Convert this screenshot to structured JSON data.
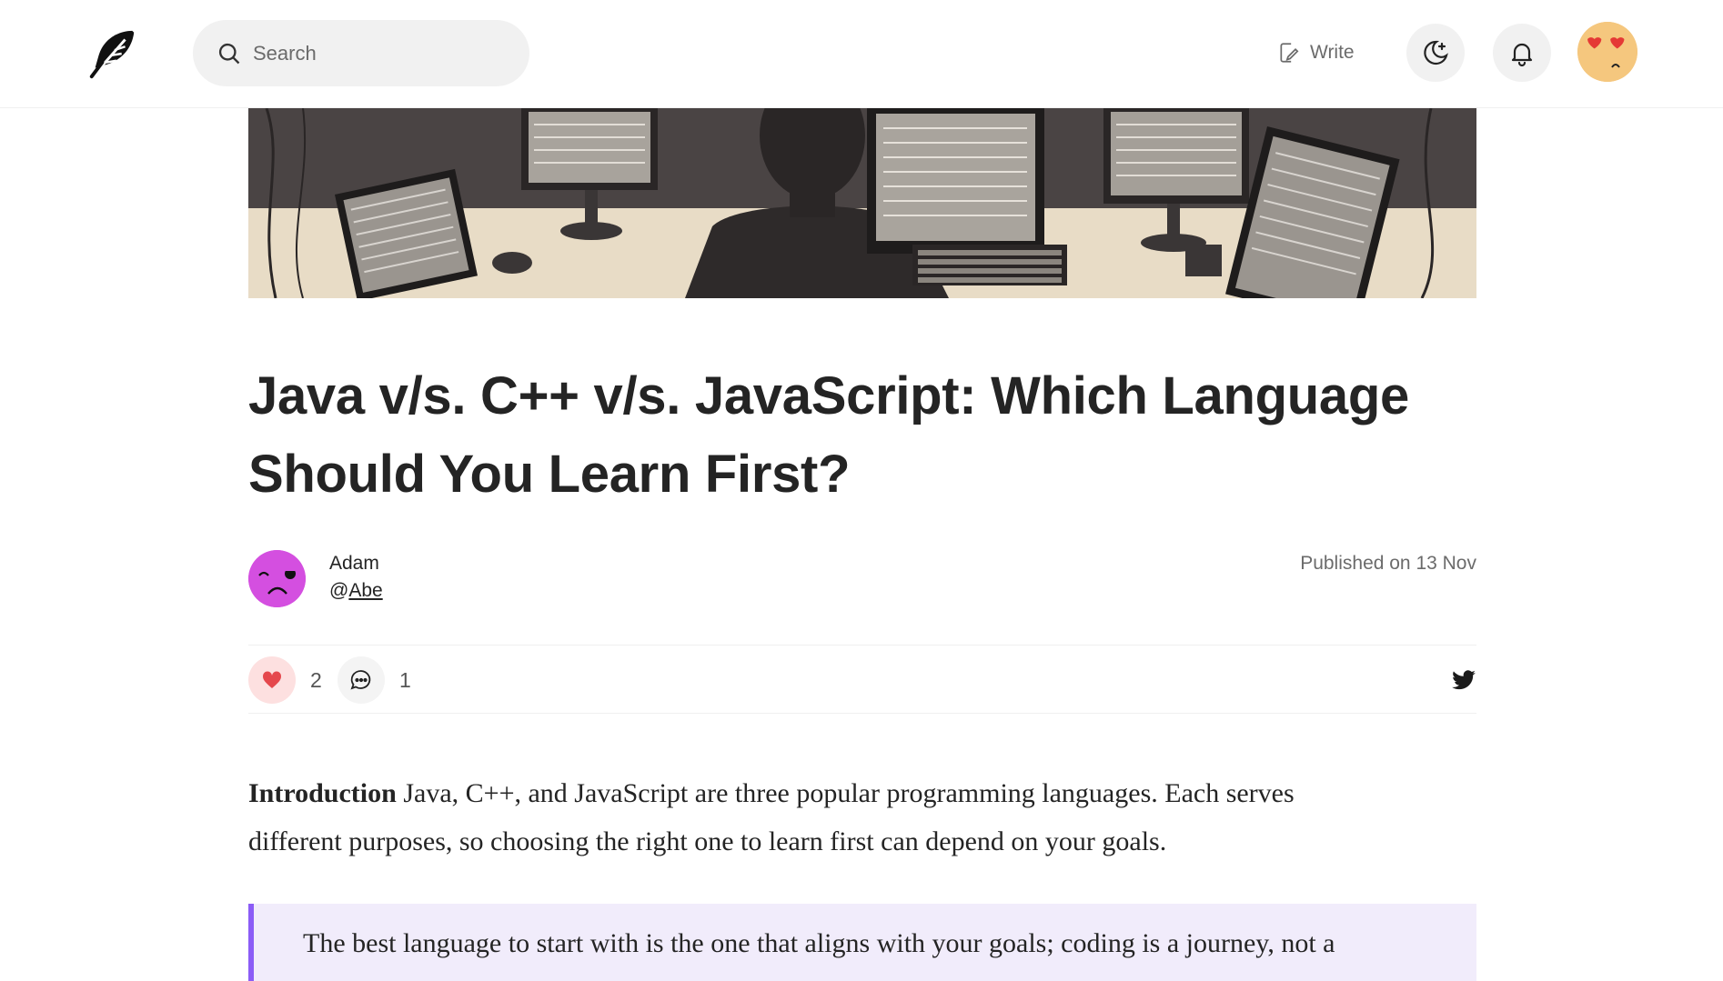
{
  "header": {
    "logo_icon": "feather-icon",
    "search": {
      "placeholder": "Search"
    },
    "write_label": "Write",
    "theme_icon": "moon-star-icon",
    "notifications_icon": "bell-icon",
    "avatar_icon": "heart-eyes-emoji"
  },
  "hero": {
    "icon": "programmer-workstation-illustration"
  },
  "article": {
    "title_line1": "Java v/s. C++ v/s. JavaScript: Which Language",
    "title_line2": "Should You Learn First?",
    "author": {
      "name": "Adam",
      "handle_prefix": "@",
      "handle": "Abe",
      "avatar_icon": "winking-face-avatar"
    },
    "published": "Published on 13 Nov",
    "reactions": {
      "likes": "2",
      "comments": "1"
    },
    "intro_bold": "Introduction",
    "intro_line1": " Java, C++, and JavaScript are three popular programming languages. Each serves",
    "intro_line2": "different purposes, so choosing the right one to learn first can depend on your goals.",
    "quote": "The best language to start with is the one that aligns with your goals; coding is a journey, not a"
  },
  "colors": {
    "accent_quote_border": "#8b5cf6",
    "quote_bg": "#f1ecfb",
    "like_bg": "#fde0e0",
    "heart": "#e5484d",
    "author_avatar": "#d44fe0",
    "header_avatar": "#f5c77e"
  }
}
